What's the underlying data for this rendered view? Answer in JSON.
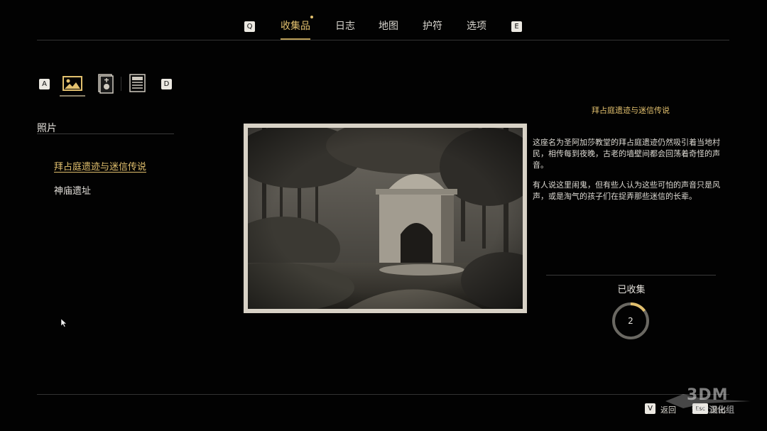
{
  "topnav": {
    "left_key": "Q",
    "right_key": "E",
    "tabs": [
      {
        "label": "收集品",
        "active": true,
        "has_notification": true
      },
      {
        "label": "日志",
        "active": false
      },
      {
        "label": "地图",
        "active": false
      },
      {
        "label": "护符",
        "active": false
      },
      {
        "label": "选项",
        "active": false
      }
    ]
  },
  "categories": {
    "left_key": "A",
    "right_key": "D",
    "items": [
      {
        "icon": "photo-icon",
        "active": true
      },
      {
        "icon": "relic-icon",
        "active": false
      },
      {
        "icon": "document-icon",
        "active": false
      }
    ]
  },
  "sidebar": {
    "section_title": "照片",
    "items": [
      {
        "label": "拜占庭遗迹与迷信传说",
        "selected": true
      },
      {
        "label": "神庙遗址",
        "selected": false
      }
    ]
  },
  "detail": {
    "title": "拜占庭遗迹与迷信传说",
    "paragraphs": [
      "这座名为圣阿加莎教堂的拜占庭遗迹仍然吸引着当地村民，相传每到夜晚，古老的墙壁间都会回荡着奇怪的声音。",
      "有人说这里闹鬼，但有些人认为这些可怕的声音只是风声，或是淘气的孩子们在捉弄那些迷信的长辈。"
    ],
    "collected_label": "已收集",
    "collected_count": "2",
    "collected_fraction": 0.15
  },
  "bottom": {
    "key1": "V",
    "label1": "返回",
    "key2": "Esc",
    "label2": "退出"
  },
  "watermark": {
    "text": "3DM",
    "subtext": "游戏汉化组"
  },
  "colors": {
    "accent": "#e2c06e",
    "text": "#d9d6cf",
    "background": "#020202"
  }
}
